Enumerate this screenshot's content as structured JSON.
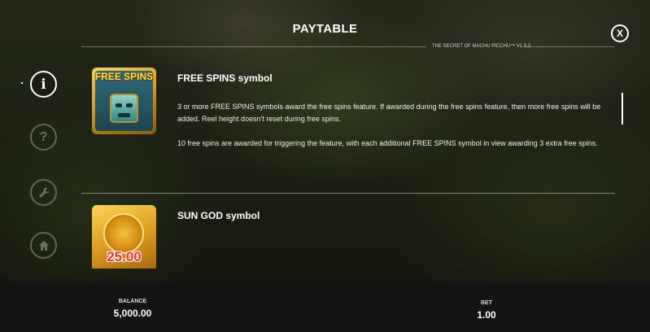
{
  "header": {
    "title": "PAYTABLE",
    "version": "THE SECRET OF MACHU PICCHU™ V1.0.2",
    "close_label": "X"
  },
  "nav": [
    {
      "id": "info",
      "glyph": "i",
      "active": true
    },
    {
      "id": "help",
      "glyph": "?",
      "active": false
    },
    {
      "id": "settings",
      "icon": "wrench-icon",
      "active": false
    },
    {
      "id": "home",
      "icon": "home-icon",
      "active": false
    }
  ],
  "symbols": [
    {
      "title": "FREE SPINS symbol",
      "badge": "FREE SPINS",
      "paragraphs": [
        "3 or more FREE SPINS symbols award the free spins feature. If awarded during the free spins feature, then more free spins will be added. Reel height doesn't reset during free spins.",
        "10 free spins are awarded for triggering the feature, with each additional FREE SPINS symbol in view awarding 3 extra free spins."
      ]
    },
    {
      "title": "SUN GOD symbol",
      "badge": "25.00"
    }
  ],
  "footer": {
    "balance_label": "BALANCE",
    "balance_value": "5,000.00",
    "bet_label": "BET",
    "bet_value": "1.00"
  }
}
